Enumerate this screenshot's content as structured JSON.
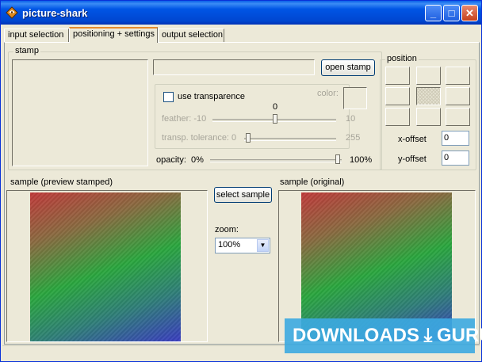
{
  "window": {
    "title": "picture-shark"
  },
  "titlebar_buttons": {
    "minimize": "_",
    "maximize": "□",
    "close": "✕"
  },
  "tabs": [
    {
      "label": "input selection"
    },
    {
      "label": "positioning + settings",
      "active": true
    },
    {
      "label": "output selection"
    }
  ],
  "stamp": {
    "group_label": "stamp",
    "open_stamp_label": "open stamp",
    "use_transparence_label": "use transparence",
    "color_label": "color:",
    "feather_label": "feather: -10",
    "feather_value": "0",
    "feather_max": "10",
    "tolerance_label": "transp. tolerance: 0",
    "tolerance_max": "255",
    "opacity_label": "opacity:",
    "opacity_min": "0%",
    "opacity_max": "100%"
  },
  "position": {
    "group_label": "position",
    "x_offset_label": "x-offset",
    "x_offset_value": "0",
    "y_offset_label": "y-offset",
    "y_offset_value": "0"
  },
  "sample": {
    "preview_label": "sample (preview stamped)",
    "original_label": "sample (original)",
    "select_sample_label": "select sample",
    "zoom_label": "zoom:",
    "zoom_value": "100%"
  },
  "watermark": {
    "left": "DOWNLOADS",
    "right": "GURU"
  },
  "colors": {
    "titlebar": "#0055e5",
    "window_bg": "#ece9d8",
    "tab_highlight": "#e68b2c",
    "watermark_bg": "#3caae1"
  }
}
